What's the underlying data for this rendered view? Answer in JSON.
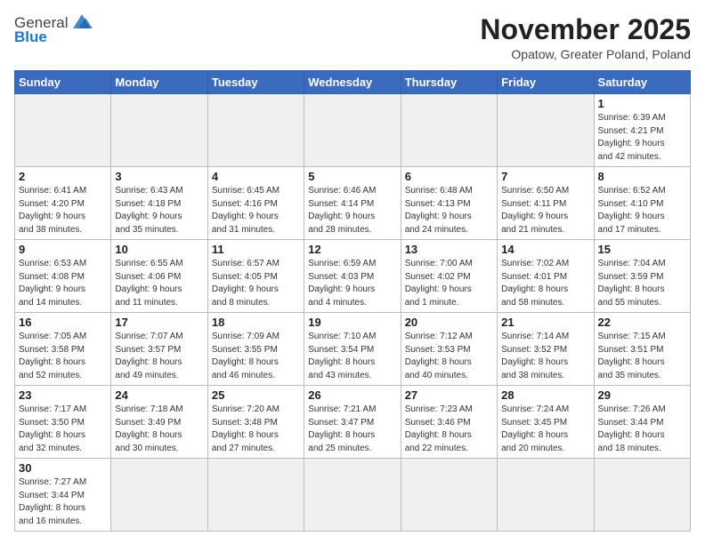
{
  "logo": {
    "text_general": "General",
    "text_blue": "Blue"
  },
  "title": "November 2025",
  "subtitle": "Opatow, Greater Poland, Poland",
  "weekdays": [
    "Sunday",
    "Monday",
    "Tuesday",
    "Wednesday",
    "Thursday",
    "Friday",
    "Saturday"
  ],
  "weeks": [
    [
      {
        "day": "",
        "info": "",
        "empty": true
      },
      {
        "day": "",
        "info": "",
        "empty": true
      },
      {
        "day": "",
        "info": "",
        "empty": true
      },
      {
        "day": "",
        "info": "",
        "empty": true
      },
      {
        "day": "",
        "info": "",
        "empty": true
      },
      {
        "day": "",
        "info": "",
        "empty": true
      },
      {
        "day": "1",
        "info": "Sunrise: 6:39 AM\nSunset: 4:21 PM\nDaylight: 9 hours\nand 42 minutes."
      }
    ],
    [
      {
        "day": "2",
        "info": "Sunrise: 6:41 AM\nSunset: 4:20 PM\nDaylight: 9 hours\nand 38 minutes."
      },
      {
        "day": "3",
        "info": "Sunrise: 6:43 AM\nSunset: 4:18 PM\nDaylight: 9 hours\nand 35 minutes."
      },
      {
        "day": "4",
        "info": "Sunrise: 6:45 AM\nSunset: 4:16 PM\nDaylight: 9 hours\nand 31 minutes."
      },
      {
        "day": "5",
        "info": "Sunrise: 6:46 AM\nSunset: 4:14 PM\nDaylight: 9 hours\nand 28 minutes."
      },
      {
        "day": "6",
        "info": "Sunrise: 6:48 AM\nSunset: 4:13 PM\nDaylight: 9 hours\nand 24 minutes."
      },
      {
        "day": "7",
        "info": "Sunrise: 6:50 AM\nSunset: 4:11 PM\nDaylight: 9 hours\nand 21 minutes."
      },
      {
        "day": "8",
        "info": "Sunrise: 6:52 AM\nSunset: 4:10 PM\nDaylight: 9 hours\nand 17 minutes."
      }
    ],
    [
      {
        "day": "9",
        "info": "Sunrise: 6:53 AM\nSunset: 4:08 PM\nDaylight: 9 hours\nand 14 minutes."
      },
      {
        "day": "10",
        "info": "Sunrise: 6:55 AM\nSunset: 4:06 PM\nDaylight: 9 hours\nand 11 minutes."
      },
      {
        "day": "11",
        "info": "Sunrise: 6:57 AM\nSunset: 4:05 PM\nDaylight: 9 hours\nand 8 minutes."
      },
      {
        "day": "12",
        "info": "Sunrise: 6:59 AM\nSunset: 4:03 PM\nDaylight: 9 hours\nand 4 minutes."
      },
      {
        "day": "13",
        "info": "Sunrise: 7:00 AM\nSunset: 4:02 PM\nDaylight: 9 hours\nand 1 minute."
      },
      {
        "day": "14",
        "info": "Sunrise: 7:02 AM\nSunset: 4:01 PM\nDaylight: 8 hours\nand 58 minutes."
      },
      {
        "day": "15",
        "info": "Sunrise: 7:04 AM\nSunset: 3:59 PM\nDaylight: 8 hours\nand 55 minutes."
      }
    ],
    [
      {
        "day": "16",
        "info": "Sunrise: 7:05 AM\nSunset: 3:58 PM\nDaylight: 8 hours\nand 52 minutes."
      },
      {
        "day": "17",
        "info": "Sunrise: 7:07 AM\nSunset: 3:57 PM\nDaylight: 8 hours\nand 49 minutes."
      },
      {
        "day": "18",
        "info": "Sunrise: 7:09 AM\nSunset: 3:55 PM\nDaylight: 8 hours\nand 46 minutes."
      },
      {
        "day": "19",
        "info": "Sunrise: 7:10 AM\nSunset: 3:54 PM\nDaylight: 8 hours\nand 43 minutes."
      },
      {
        "day": "20",
        "info": "Sunrise: 7:12 AM\nSunset: 3:53 PM\nDaylight: 8 hours\nand 40 minutes."
      },
      {
        "day": "21",
        "info": "Sunrise: 7:14 AM\nSunset: 3:52 PM\nDaylight: 8 hours\nand 38 minutes."
      },
      {
        "day": "22",
        "info": "Sunrise: 7:15 AM\nSunset: 3:51 PM\nDaylight: 8 hours\nand 35 minutes."
      }
    ],
    [
      {
        "day": "23",
        "info": "Sunrise: 7:17 AM\nSunset: 3:50 PM\nDaylight: 8 hours\nand 32 minutes."
      },
      {
        "day": "24",
        "info": "Sunrise: 7:18 AM\nSunset: 3:49 PM\nDaylight: 8 hours\nand 30 minutes."
      },
      {
        "day": "25",
        "info": "Sunrise: 7:20 AM\nSunset: 3:48 PM\nDaylight: 8 hours\nand 27 minutes."
      },
      {
        "day": "26",
        "info": "Sunrise: 7:21 AM\nSunset: 3:47 PM\nDaylight: 8 hours\nand 25 minutes."
      },
      {
        "day": "27",
        "info": "Sunrise: 7:23 AM\nSunset: 3:46 PM\nDaylight: 8 hours\nand 22 minutes."
      },
      {
        "day": "28",
        "info": "Sunrise: 7:24 AM\nSunset: 3:45 PM\nDaylight: 8 hours\nand 20 minutes."
      },
      {
        "day": "29",
        "info": "Sunrise: 7:26 AM\nSunset: 3:44 PM\nDaylight: 8 hours\nand 18 minutes."
      }
    ],
    [
      {
        "day": "30",
        "info": "Sunrise: 7:27 AM\nSunset: 3:44 PM\nDaylight: 8 hours\nand 16 minutes.",
        "last": true
      },
      {
        "day": "",
        "info": "",
        "empty": true,
        "last": true
      },
      {
        "day": "",
        "info": "",
        "empty": true,
        "last": true
      },
      {
        "day": "",
        "info": "",
        "empty": true,
        "last": true
      },
      {
        "day": "",
        "info": "",
        "empty": true,
        "last": true
      },
      {
        "day": "",
        "info": "",
        "empty": true,
        "last": true
      },
      {
        "day": "",
        "info": "",
        "empty": true,
        "last": true
      }
    ]
  ]
}
